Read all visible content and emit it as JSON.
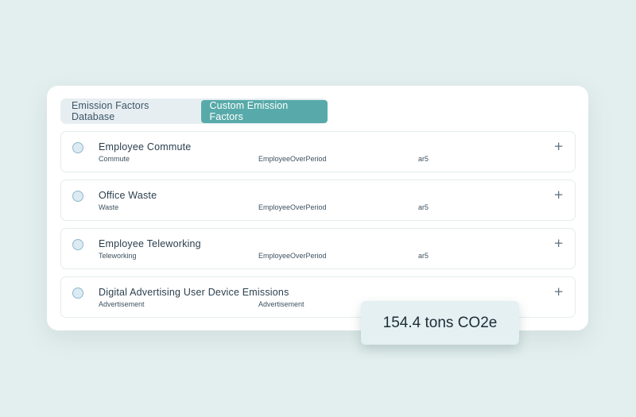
{
  "tabs": [
    {
      "label": "Emission Factors Database",
      "active": false
    },
    {
      "label": "Custom Emission Factors",
      "active": true
    }
  ],
  "rows": [
    {
      "title": "Employee Commute",
      "category": "Commute",
      "type": "EmployeeOverPeriod",
      "source": "ar5",
      "expand_icon": "plus-icon"
    },
    {
      "title": "Office Waste",
      "category": "Waste",
      "type": "EmployeeOverPeriod",
      "source": "ar5",
      "expand_icon": "plus-icon"
    },
    {
      "title": "Employee Teleworking",
      "category": "Teleworking",
      "type": "EmployeeOverPeriod",
      "source": "ar5",
      "expand_icon": "plus-icon"
    },
    {
      "title": "Digital Advertising User Device Emissions",
      "category": "Advertisement",
      "type": "Advertisement",
      "source": "",
      "expand_icon": "plus-icon"
    }
  ],
  "summary": {
    "total": "154.4 tons CO2e"
  },
  "colors": {
    "accent": "#57aaa9",
    "background": "#e3efee"
  }
}
